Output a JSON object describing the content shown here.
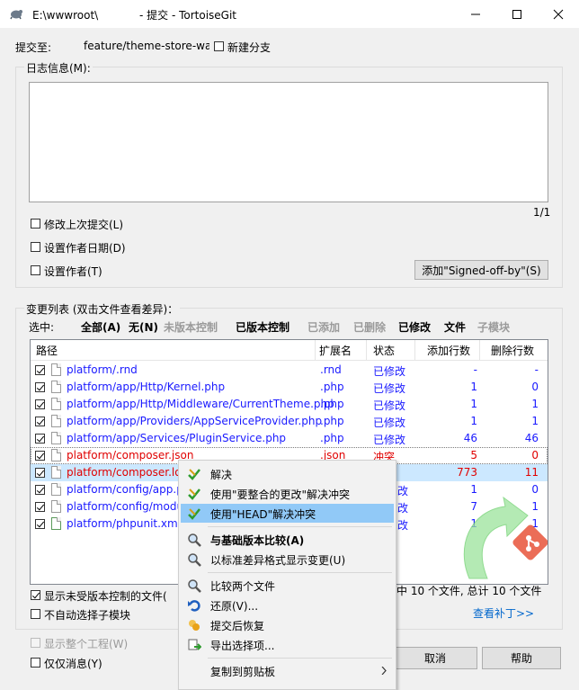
{
  "titlebar": {
    "title": "E:\\wwwroot\\            - 提交 - TortoiseGit"
  },
  "commit_to": {
    "label": "提交至:",
    "branch": "feature/theme-store-wang",
    "new_branch_label": "新建分支"
  },
  "log": {
    "group_label": "日志信息(M):",
    "message": "",
    "counter": "1/1",
    "amend_label": "修改上次提交(L)",
    "set_date_label": "设置作者日期(D)",
    "set_author_label": "设置作者(T)",
    "signed_off_button": "添加\"Signed-off-by\"(S)"
  },
  "changes": {
    "group_label": "变更列表 (双击文件查看差异)：",
    "select_label": "选中:",
    "filters": [
      "全部(A)",
      "无(N)",
      "未版本控制",
      "已版本控制",
      "已添加",
      "已删除",
      "已修改",
      "文件",
      "子模块"
    ],
    "columns": [
      "路径",
      "扩展名",
      "状态",
      "添加行数",
      "删除行数"
    ],
    "rows": [
      {
        "path": "platform/.rnd",
        "ext": ".rnd",
        "status": "已修改",
        "added": "-",
        "deleted": "-"
      },
      {
        "path": "platform/app/Http/Kernel.php",
        "ext": ".php",
        "status": "已修改",
        "added": "1",
        "deleted": "0"
      },
      {
        "path": "platform/app/Http/Middleware/CurrentTheme.php",
        "ext": ".php",
        "status": "已修改",
        "added": "1",
        "deleted": "1"
      },
      {
        "path": "platform/app/Providers/AppServiceProvider.php",
        "ext": ".php",
        "status": "已修改",
        "added": "1",
        "deleted": "1"
      },
      {
        "path": "platform/app/Services/PluginService.php",
        "ext": ".php",
        "status": "已修改",
        "added": "46",
        "deleted": "46"
      },
      {
        "path": "platform/composer.json",
        "ext": ".json",
        "status": "冲突",
        "added": "5",
        "deleted": "0"
      },
      {
        "path": "platform/composer.lock",
        "ext": "",
        "status": "",
        "added": "773",
        "deleted": "11"
      },
      {
        "path": "platform/config/app.ph",
        "ext": "",
        "status": "改",
        "added": "1",
        "deleted": "0"
      },
      {
        "path": "platform/config/modul",
        "ext": "",
        "status": "改",
        "added": "7",
        "deleted": "1"
      },
      {
        "path": "platform/phpunit.xml",
        "ext": "",
        "status": "改",
        "added": "1",
        "deleted": "1"
      }
    ],
    "show_unversioned_label": "显示未受版本控制的文件(",
    "no_autoselect_submodules_label": "不自动选择子模块",
    "summary": "中 10 个文件, 总计 10 个文件",
    "view_patch_link": "查看补丁>>"
  },
  "bottom": {
    "show_whole_project_label": "显示整个工程(W)",
    "message_only_label": "仅仅消息(Y)",
    "cancel_button": "取消",
    "help_button": "帮助"
  },
  "context_menu": {
    "items": [
      {
        "label": "解决",
        "icon": "resolve-check-icon"
      },
      {
        "label": "使用\"要整合的更改\"解决冲突",
        "icon": "resolve-check-icon"
      },
      {
        "label": "使用\"HEAD\"解决冲突",
        "icon": "resolve-check-icon"
      },
      {
        "label": "与基础版本比较(A)",
        "icon": "magnifier-icon"
      },
      {
        "label": "以标准差异格式显示变更(U)",
        "icon": "magnifier-icon"
      },
      {
        "label": "比较两个文件",
        "icon": "magnifier-icon"
      },
      {
        "label": "还原(V)...",
        "icon": "revert-arrow-icon"
      },
      {
        "label": "提交后恢复",
        "icon": "restore-icon"
      },
      {
        "label": "导出选择项...",
        "icon": "export-icon"
      },
      {
        "label": "复制到剪贴板",
        "icon": ""
      }
    ]
  },
  "colors": {
    "link_blue": "#1a1aff",
    "conflict_red": "#e00000",
    "menu_highlight": "#91c9f7",
    "selected_row": "#cce8ff"
  }
}
